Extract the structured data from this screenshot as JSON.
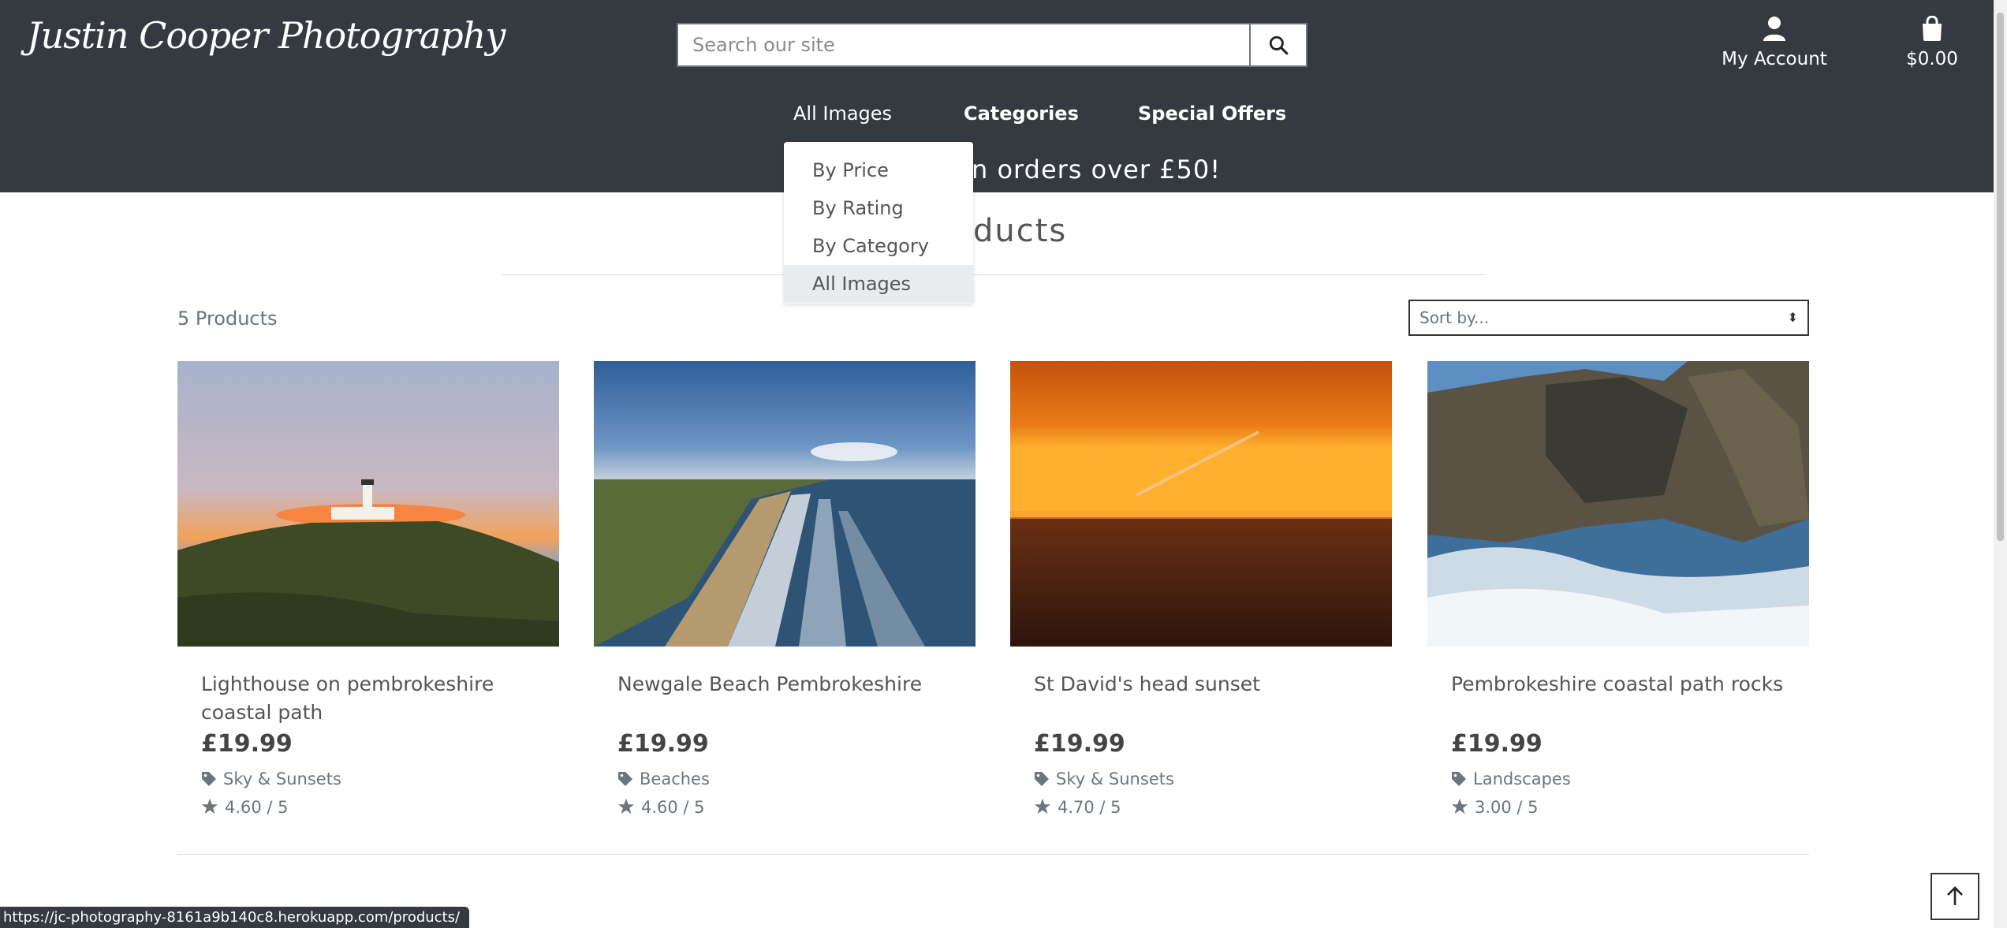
{
  "header": {
    "logo": "Justin Cooper Photography",
    "search": {
      "placeholder": "Search our site"
    },
    "account_label": "My Account",
    "cart_total": "$0.00",
    "promo_partial": "n orders over £50!"
  },
  "nav": {
    "items": [
      {
        "label": "All Images"
      },
      {
        "label": "Categories"
      },
      {
        "label": "Special Offers"
      }
    ],
    "dropdown": [
      {
        "label": "By Price"
      },
      {
        "label": "By Rating"
      },
      {
        "label": "By Category"
      },
      {
        "label": "All Images"
      }
    ]
  },
  "main": {
    "heading_partial": "ducts",
    "count": "5 Products",
    "sort_placeholder": "Sort by...",
    "products": [
      {
        "title": "Lighthouse on pembrokeshire coastal path",
        "price": "£19.99",
        "category": "Sky & Sunsets",
        "rating": "4.60 / 5"
      },
      {
        "title": "Newgale Beach Pembrokeshire",
        "price": "£19.99",
        "category": "Beaches",
        "rating": "4.60 / 5"
      },
      {
        "title": "St David's head sunset",
        "price": "£19.99",
        "category": "Sky & Sunsets",
        "rating": "4.70 / 5"
      },
      {
        "title": "Pembrokeshire coastal path rocks",
        "price": "£19.99",
        "category": "Landscapes",
        "rating": "3.00 / 5"
      }
    ]
  },
  "status_url": "https://jc-photography-8161a9b140c8.herokuapp.com/products/",
  "colors": {
    "header_bg": "#343a40",
    "dropdown_selected": "#e9ecef"
  },
  "icons": [
    "search-icon",
    "user-icon",
    "shopping-bag-icon",
    "tag-icon",
    "star-icon",
    "arrow-up-icon"
  ]
}
